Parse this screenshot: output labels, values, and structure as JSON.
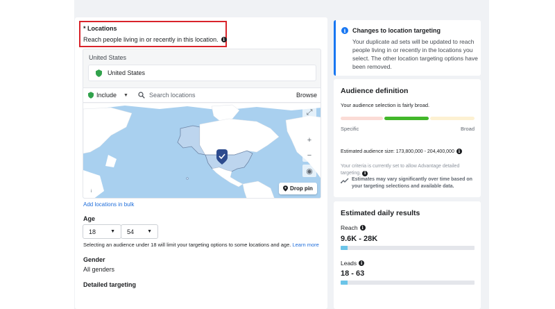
{
  "locations": {
    "title": "* Locations",
    "description": "Reach people living in or recently in this location.",
    "country_header": "United States",
    "selected_country": "United States",
    "include_label": "Include",
    "search_placeholder": "Search locations",
    "browse_label": "Browse",
    "zoom_in": "+",
    "zoom_out": "−",
    "drop_pin_label": "Drop pin",
    "add_bulk_link": "Add locations in bulk"
  },
  "age": {
    "label": "Age",
    "min": "18",
    "max": "54",
    "hint": "Selecting an audience under 18 will limit your targeting options to some locations and age.",
    "learn_more": "Learn more"
  },
  "gender": {
    "label": "Gender",
    "value": "All genders"
  },
  "detailed_targeting": {
    "label": "Detailed targeting"
  },
  "notice": {
    "title": "Changes to location targeting",
    "body": "Your duplicate ad sets will be updated to reach people living in or recently in the locations you select. The other location targeting options have been removed."
  },
  "audience": {
    "title": "Audience definition",
    "breadth_text": "Your audience selection is fairly broad.",
    "meter_level": "broad",
    "specific_label": "Specific",
    "broad_label": "Broad",
    "estimated_size": "Estimated audience size: 173,800,000 - 204,400,000",
    "criteria_note": "Your criteria is currently set to allow Advantage detailed targeting.",
    "estimates_note": "Estimates may vary significantly over time based on your targeting selections and available data."
  },
  "daily_results": {
    "title": "Estimated daily results",
    "reach_label": "Reach",
    "reach_value": "9.6K - 28K",
    "reach_fill": 0.05,
    "leads_label": "Leads",
    "leads_value": "18 - 63",
    "leads_fill": 0.05
  },
  "colors": {
    "accent": "#1877f2",
    "highlight_border": "#d8232a",
    "meter_active": "#42b72a",
    "pin_green": "#31a24c",
    "bar_fill": "#6bc4e8"
  }
}
